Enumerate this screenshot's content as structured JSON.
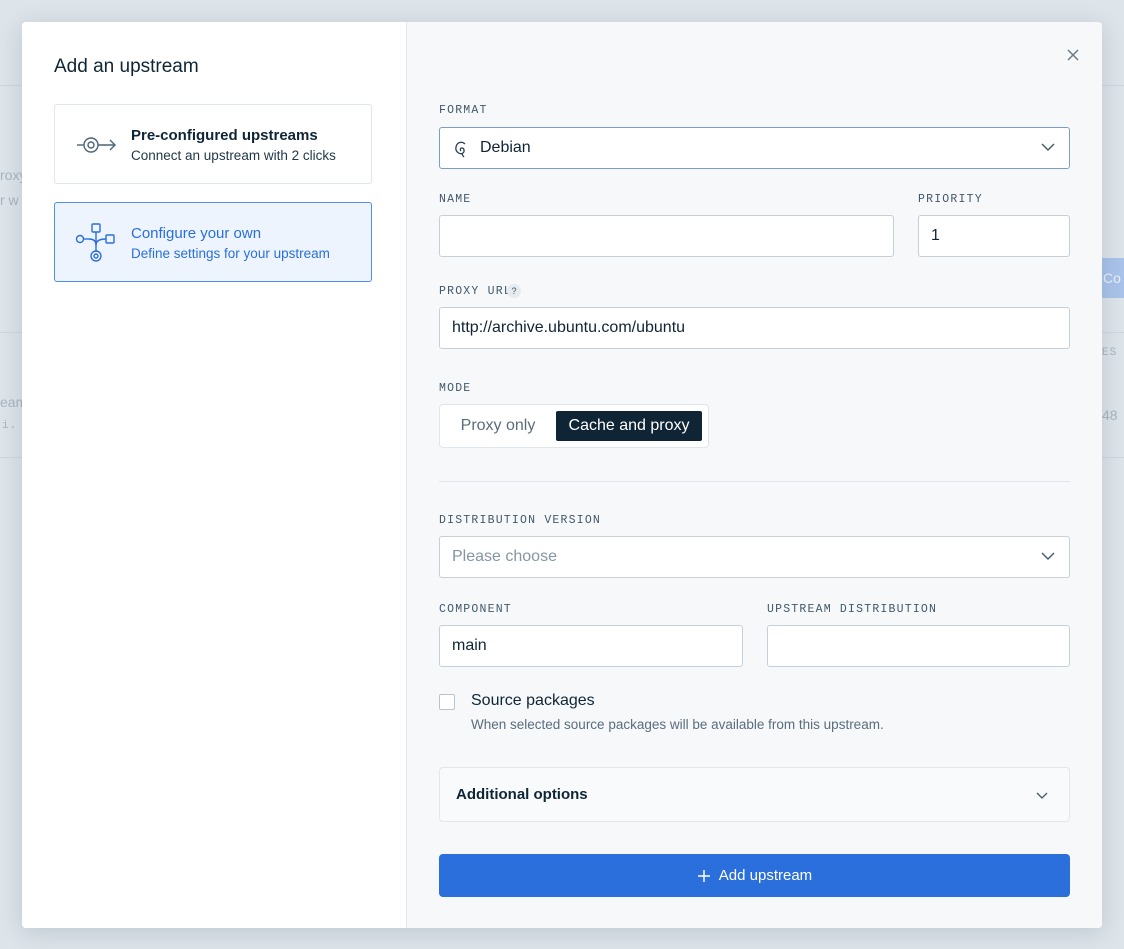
{
  "modal": {
    "title": "Add an upstream",
    "options": [
      {
        "title": "Pre-configured upstreams",
        "subtitle": "Connect an upstream with 2 clicks",
        "icon": "preconfigured-upstream-icon",
        "active": false
      },
      {
        "title": "Configure your own",
        "subtitle": "Define settings for your upstream",
        "icon": "configure-upstream-icon",
        "active": true
      }
    ],
    "close_icon": "close-icon"
  },
  "form": {
    "format": {
      "label": "FORMAT",
      "value": "Debian",
      "icon": "debian-icon"
    },
    "name": {
      "label": "NAME",
      "value": ""
    },
    "priority": {
      "label": "PRIORITY",
      "value": "1"
    },
    "proxy_url": {
      "label": "PROXY URL",
      "help": "?",
      "value": "http://archive.ubuntu.com/ubuntu"
    },
    "mode": {
      "label": "MODE",
      "options": [
        "Proxy only",
        "Cache and proxy"
      ],
      "selected": "Cache and proxy"
    },
    "distribution_version": {
      "label": "DISTRIBUTION VERSION",
      "placeholder": "Please choose"
    },
    "component": {
      "label": "COMPONENT",
      "value": "main"
    },
    "upstream_distribution": {
      "label": "UPSTREAM DISTRIBUTION",
      "value": ""
    },
    "source_packages": {
      "label": "Source packages",
      "help": "When selected source packages will be available from this upstream.",
      "checked": false
    },
    "additional_options": {
      "label": "Additional options"
    },
    "submit": {
      "label": "Add upstream"
    }
  },
  "background": {
    "fragments": [
      "roxy",
      "r w",
      "eam",
      "i.",
      "Co",
      "ES",
      "48"
    ]
  },
  "colors": {
    "primary": "#2a6fdb",
    "dark": "#0f2536",
    "active_border": "#4e8ff0"
  }
}
